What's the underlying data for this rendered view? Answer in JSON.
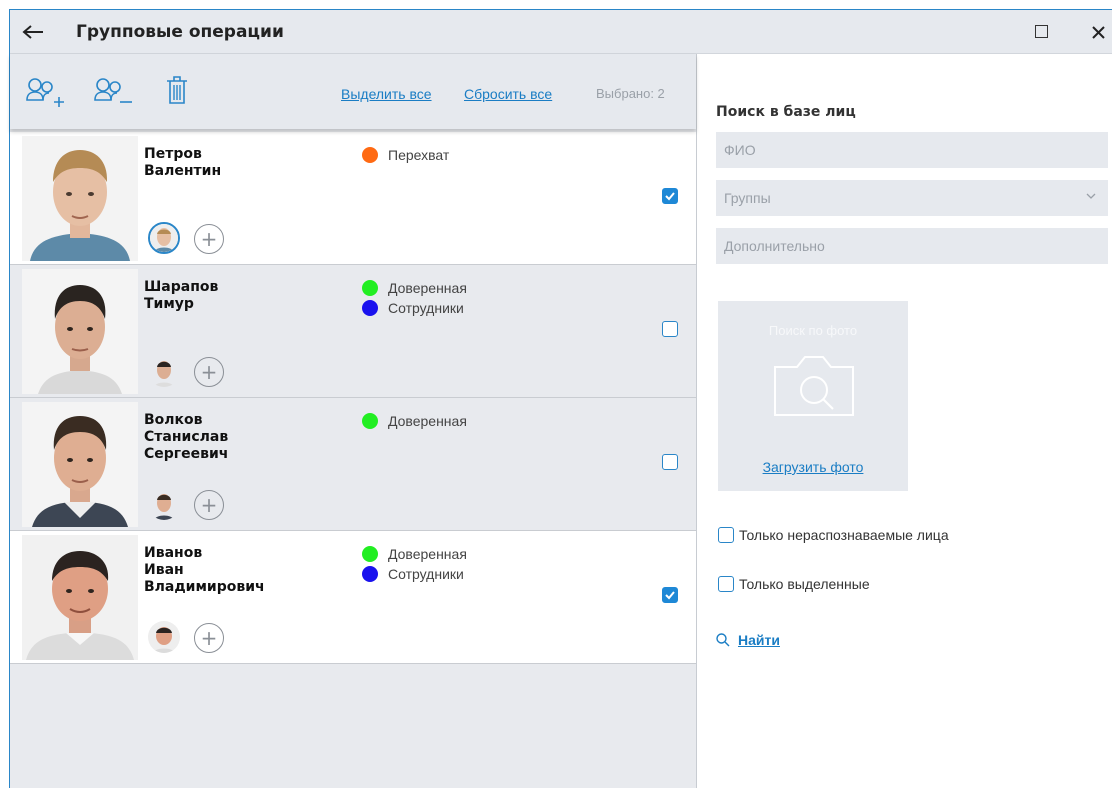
{
  "window": {
    "title": "Групповые операции"
  },
  "toolbar": {
    "add_person_icon": "add-person-icon",
    "remove_person_icon": "remove-person-icon",
    "delete_icon": "trash-icon",
    "select_all": "Выделить все",
    "reset_all": "Сбросить все",
    "selected_count": "Выбрано: 2"
  },
  "people": [
    {
      "last_name": "Петров",
      "first_name": "Валентин",
      "middle_name": "",
      "groups": [
        {
          "name": "Перехват",
          "color": "#ff6a13"
        }
      ],
      "checked": true
    },
    {
      "last_name": "Шарапов",
      "first_name": "Тимур",
      "middle_name": "",
      "groups": [
        {
          "name": "Доверенная",
          "color": "#22ee22"
        },
        {
          "name": "Сотрудники",
          "color": "#1a12ee"
        }
      ],
      "checked": false
    },
    {
      "last_name": "Волков",
      "first_name": "Станислав",
      "middle_name": "Сергеевич",
      "groups": [
        {
          "name": "Доверенная",
          "color": "#22ee22"
        }
      ],
      "checked": false
    },
    {
      "last_name": "Иванов",
      "first_name": "Иван",
      "middle_name": "Владимирович",
      "groups": [
        {
          "name": "Доверенная",
          "color": "#22ee22"
        },
        {
          "name": "Сотрудники",
          "color": "#1a12ee"
        }
      ],
      "checked": true
    }
  ],
  "search": {
    "title": "Поиск в базе лиц",
    "fio_placeholder": "ФИО",
    "groups_placeholder": "Группы",
    "extra_placeholder": "Дополнительно",
    "photo_search_label": "Поиск по фото",
    "upload_photo": "Загрузить фото",
    "only_unrecognized": "Только нераспознаваемые лица",
    "only_selected": "Только выделенные",
    "find": "Найти"
  },
  "colors": {
    "accent": "#1a7dc4",
    "checkbox": "#1e88d6"
  }
}
